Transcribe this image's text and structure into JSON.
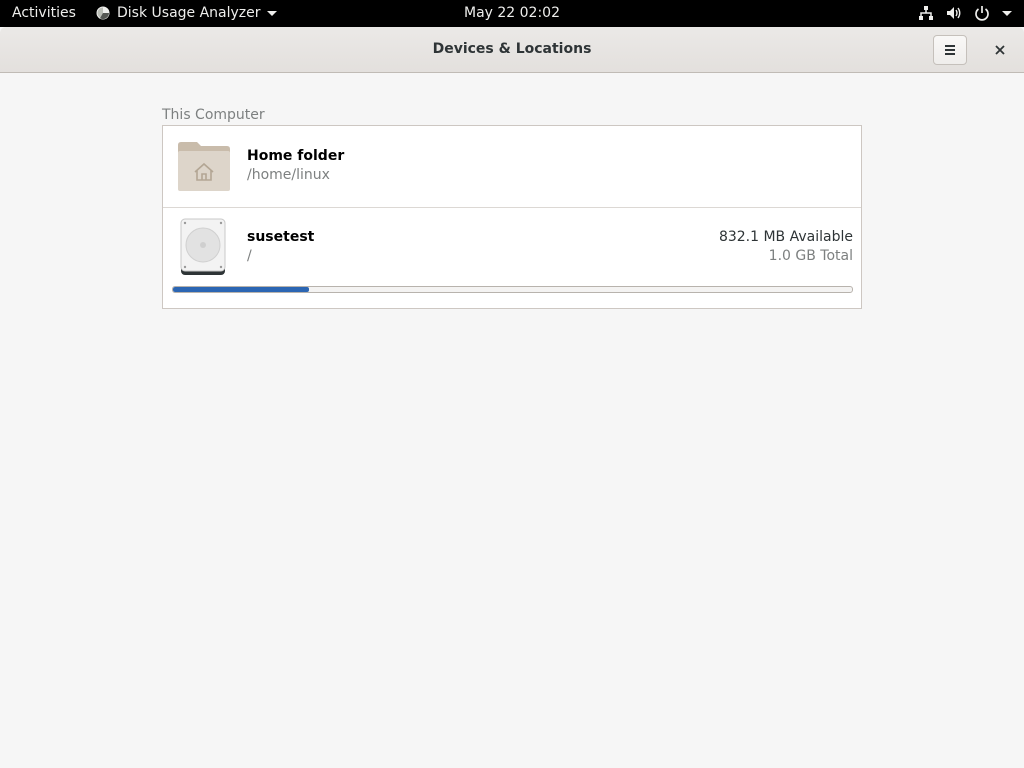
{
  "topbar": {
    "activities": "Activities",
    "app_name": "Disk Usage Analyzer",
    "clock": "May 22  02:02",
    "icons": [
      "network-icon",
      "volume-icon",
      "power-icon"
    ]
  },
  "window": {
    "title": "Devices & Locations",
    "menu_icon": "hamburger-menu-icon",
    "close_icon": "close-icon"
  },
  "section": {
    "label": "This Computer"
  },
  "locations": [
    {
      "icon": "home-folder-icon",
      "name": "Home folder",
      "path": "/home/linux"
    },
    {
      "icon": "hard-disk-icon",
      "name": "susetest",
      "path": "/",
      "available": "832.1 MB Available",
      "total": "1.0 GB Total",
      "usage_fraction": 0.2
    }
  ],
  "colors": {
    "usage_bar": "#2c66b3",
    "topbar_bg": "#000000",
    "window_bg": "#f6f6f6"
  }
}
